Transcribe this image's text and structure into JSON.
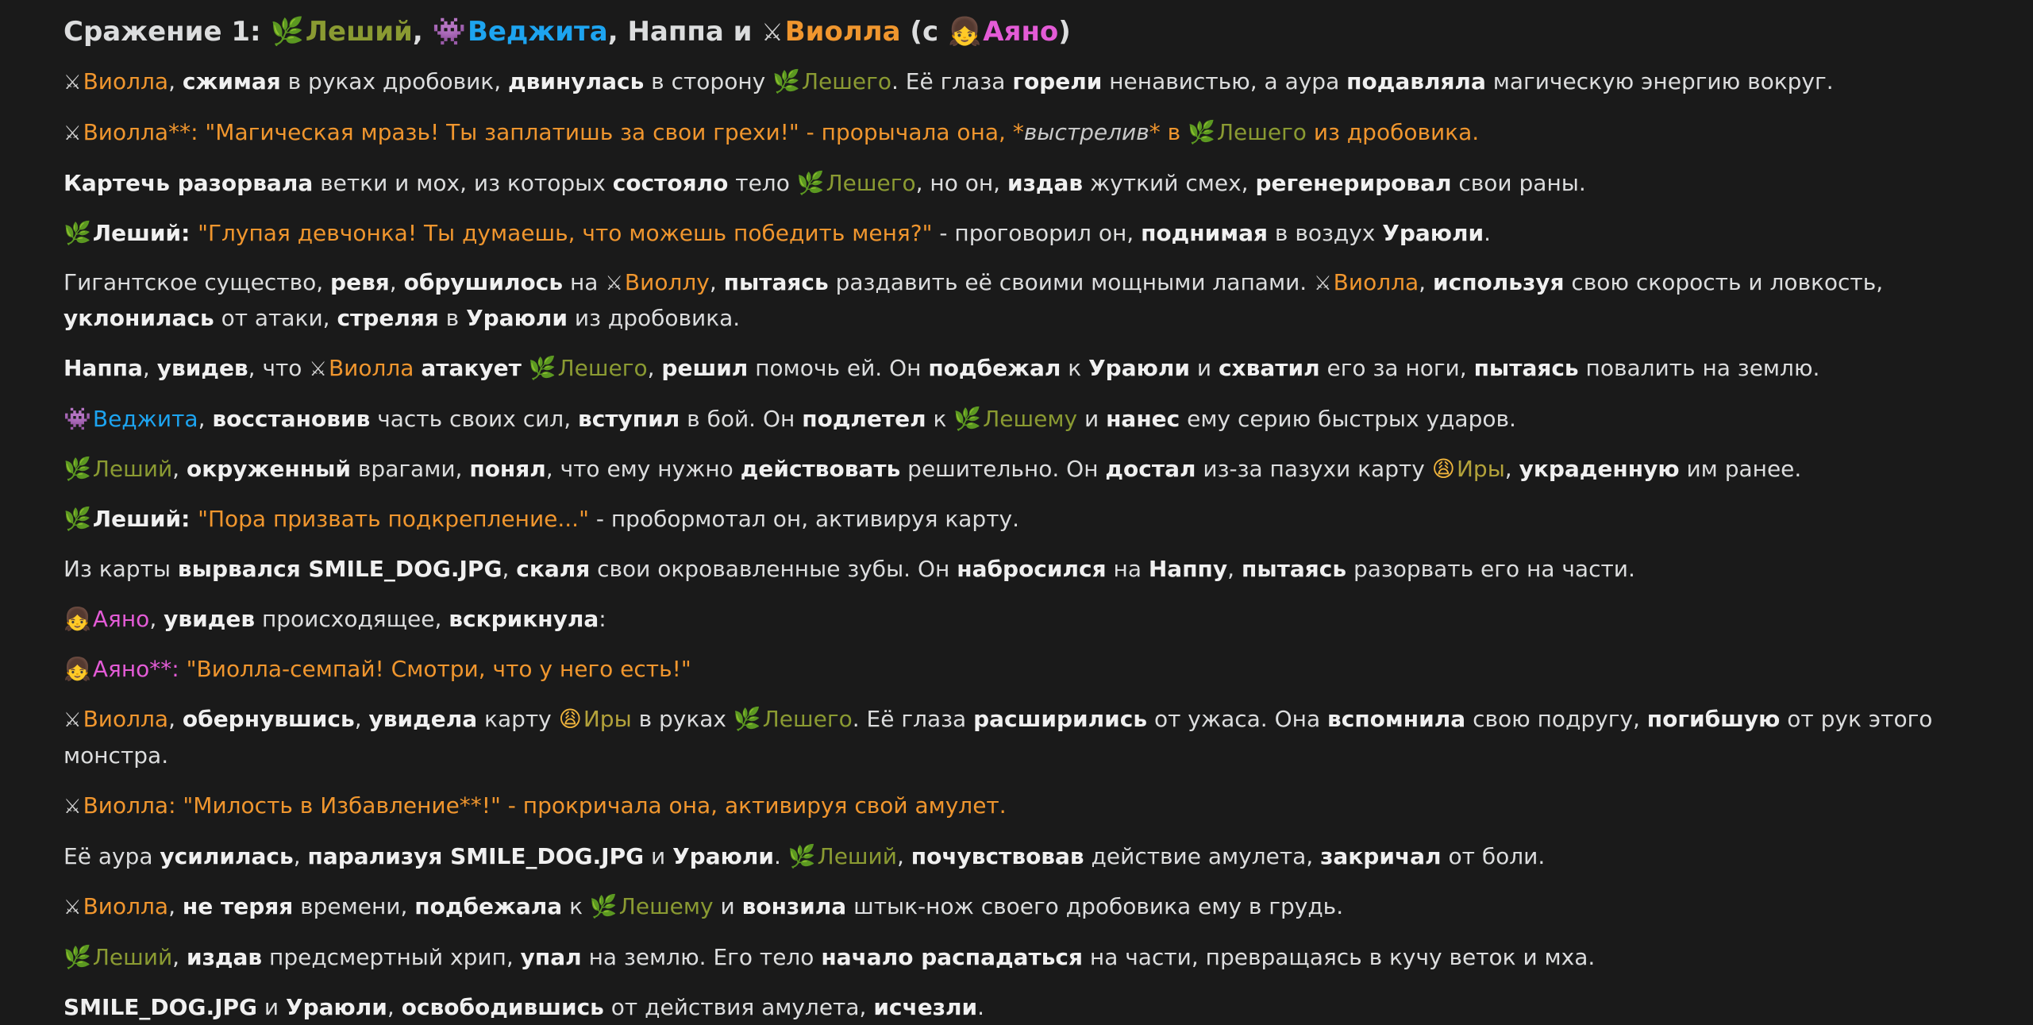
{
  "title": {
    "prefix": "Сражение 1: ",
    "leshiy": "Леший",
    "vegeta": "Веджита",
    "nappa_and": ", Наппа и ",
    "violla": "Виолла",
    "with_open": " (с ",
    "ayano": "Аяно",
    "close": ")"
  },
  "icons": {
    "leshiy": "🌿",
    "violla": "⚔",
    "vegeta": "👾",
    "ayano": "👧",
    "ira": "😩"
  },
  "p1": {
    "a": "Виолла",
    "b": ", ",
    "c": "сжимая",
    "d": " в руках дробовик, ",
    "e": "двинулась",
    "f": " в сторону ",
    "g": "Лешего",
    "h": ". Её глаза ",
    "i": "горели",
    "j": " ненавистью, а аура ",
    "k": "подавляла",
    "l": " магическую энергию вокруг."
  },
  "p2": {
    "a": "Виолла**: \"Магическая мразь! Ты заплатишь за свои грехи!\" - прорычала она, *",
    "b": "выстрелив",
    "c": "* в ",
    "d": "Лешего",
    "e": " из дробовика."
  },
  "p3": {
    "a": "Картечь разорвала",
    "b": " ветки и мох, из которых ",
    "c": "состояло",
    "d": " тело ",
    "e": "Лешего",
    "f": ", но он, ",
    "g": "издав",
    "h": " жуткий смех, ",
    "i": "регенерировал",
    "j": " свои раны."
  },
  "p4": {
    "a": "Леший",
    "b": ": ",
    "c": "\"Глупая девчонка! Ты думаешь, что можешь победить меня?\"",
    "d": " - проговорил он, ",
    "e": "поднимая",
    "f": " в воздух ",
    "g": "Ураюли",
    "h": "."
  },
  "p5": {
    "a": "Гигантское существо, ",
    "b": "ревя",
    "c": ", ",
    "d": "обрушилось",
    "e": " на ",
    "f": "Виоллу",
    "g": ", ",
    "h": "пытаясь",
    "i": " раздавить её своими мощными лапами. ",
    "j": "Виолла",
    "k": ", ",
    "l": "используя",
    "m": " свою скорость и ловкость, ",
    "n": "уклонилась",
    "o": " от атаки, ",
    "p": "стреляя",
    "q": " в ",
    "r": "Ураюли",
    "s": " из дробовика."
  },
  "p6": {
    "a": "Наппа",
    "b": ", ",
    "c": "увидев",
    "d": ", что ",
    "e": "Виолла",
    "f": " ",
    "g": "атакует",
    "h": " ",
    "i": "Лешего",
    "j": ", ",
    "k": "решил",
    "l": " помочь ей. Он ",
    "m": "подбежал",
    "n": " к ",
    "o": "Ураюли",
    "p": " и ",
    "q": "схватил",
    "r": " его за ноги, ",
    "s": "пытаясь",
    "t": " повалить на землю."
  },
  "p7": {
    "a": "Веджита",
    "b": ", ",
    "c": "восстановив",
    "d": " часть своих сил, ",
    "e": "вступил",
    "f": " в бой. Он ",
    "g": "подлетел",
    "h": " к ",
    "i": "Лешему",
    "j": " и ",
    "k": "нанес",
    "l": " ему серию быстрых ударов."
  },
  "p8": {
    "a": "Леший",
    "b": ", ",
    "c": "окруженный",
    "d": " врагами, ",
    "e": "понял",
    "f": ", что ему нужно ",
    "g": "действовать",
    "h": " решительно. Он ",
    "i": "достал",
    "j": " из-за пазухи карту ",
    "k": "Иры",
    "l": ", ",
    "m": "украденную",
    "n": " им ранее."
  },
  "p9": {
    "a": "Леший",
    "b": ": ",
    "c": "\"Пора призвать подкрепление...\"",
    "d": " - пробормотал он, активируя карту."
  },
  "p10": {
    "a": "Из карты ",
    "b": "вырвался SMILE_DOG.JPG",
    "c": ", ",
    "d": "скаля",
    "e": " свои окровавленные зубы. Он ",
    "f": "набросился",
    "g": " на ",
    "h": "Наппу",
    "i": ", ",
    "j": "пытаясь",
    "k": " разорвать его на части."
  },
  "p11": {
    "a": "Аяно",
    "b": ", ",
    "c": "увидев",
    "d": " происходящее, ",
    "e": "вскрикнула",
    "f": ":"
  },
  "p12": {
    "a": "Аяно**: ",
    "b": "\"Виолла-семпай! Смотри, что у него есть!\""
  },
  "p13": {
    "a": "Виолла",
    "b": ", ",
    "c": "обернувшись",
    "d": ", ",
    "e": "увидела",
    "f": " карту ",
    "g": "Иры",
    "h": " в руках ",
    "i": "Лешего",
    "j": ". Её глаза ",
    "k": "расширились",
    "l": " от ужаса. Она ",
    "m": "вспомнила",
    "n": " свою подругу, ",
    "o": "погибшую",
    "p": " от рук этого монстра."
  },
  "p14": {
    "a": "Виолла: \"Милость в Избавление**!\" - прокричала она, активируя свой амулет."
  },
  "p15": {
    "a": "Её аура ",
    "b": "усилилась",
    "c": ", ",
    "d": "парализуя SMILE_DOG.JPG",
    "e": " и ",
    "f": "Ураюли",
    "g": ". ",
    "h": "Леший",
    "i": ", ",
    "j": "почувствовав",
    "k": " действие амулета, ",
    "l": "закричал",
    "m": " от боли."
  },
  "p16": {
    "a": "Виолла",
    "b": ", ",
    "c": "не теряя",
    "d": " времени, ",
    "e": "подбежала",
    "f": " к ",
    "g": "Лешему",
    "h": " и ",
    "i": "вонзила",
    "j": " штык-нож своего дробовика ему в грудь."
  },
  "p17": {
    "a": "Леший",
    "b": ", ",
    "c": "издав",
    "d": " предсмертный хрип, ",
    "e": "упал",
    "f": " на землю. Его тело ",
    "g": "начало распадаться",
    "h": " на части, превращаясь в кучу веток и мха."
  },
  "p18": {
    "a": "SMILE_DOG.JPG",
    "b": " и ",
    "c": "Ураюли",
    "d": ", ",
    "e": "освободившись",
    "f": " от действия амулета, ",
    "g": "исчезли",
    "h": "."
  },
  "colors": {
    "background": "#1a1a1a",
    "text": "#dcddde",
    "leshiy": "#8a9a32",
    "violla": "#f0962e",
    "vegeta": "#1da4f0",
    "ayano": "#e35bd6",
    "ira": "#b3a23a"
  }
}
